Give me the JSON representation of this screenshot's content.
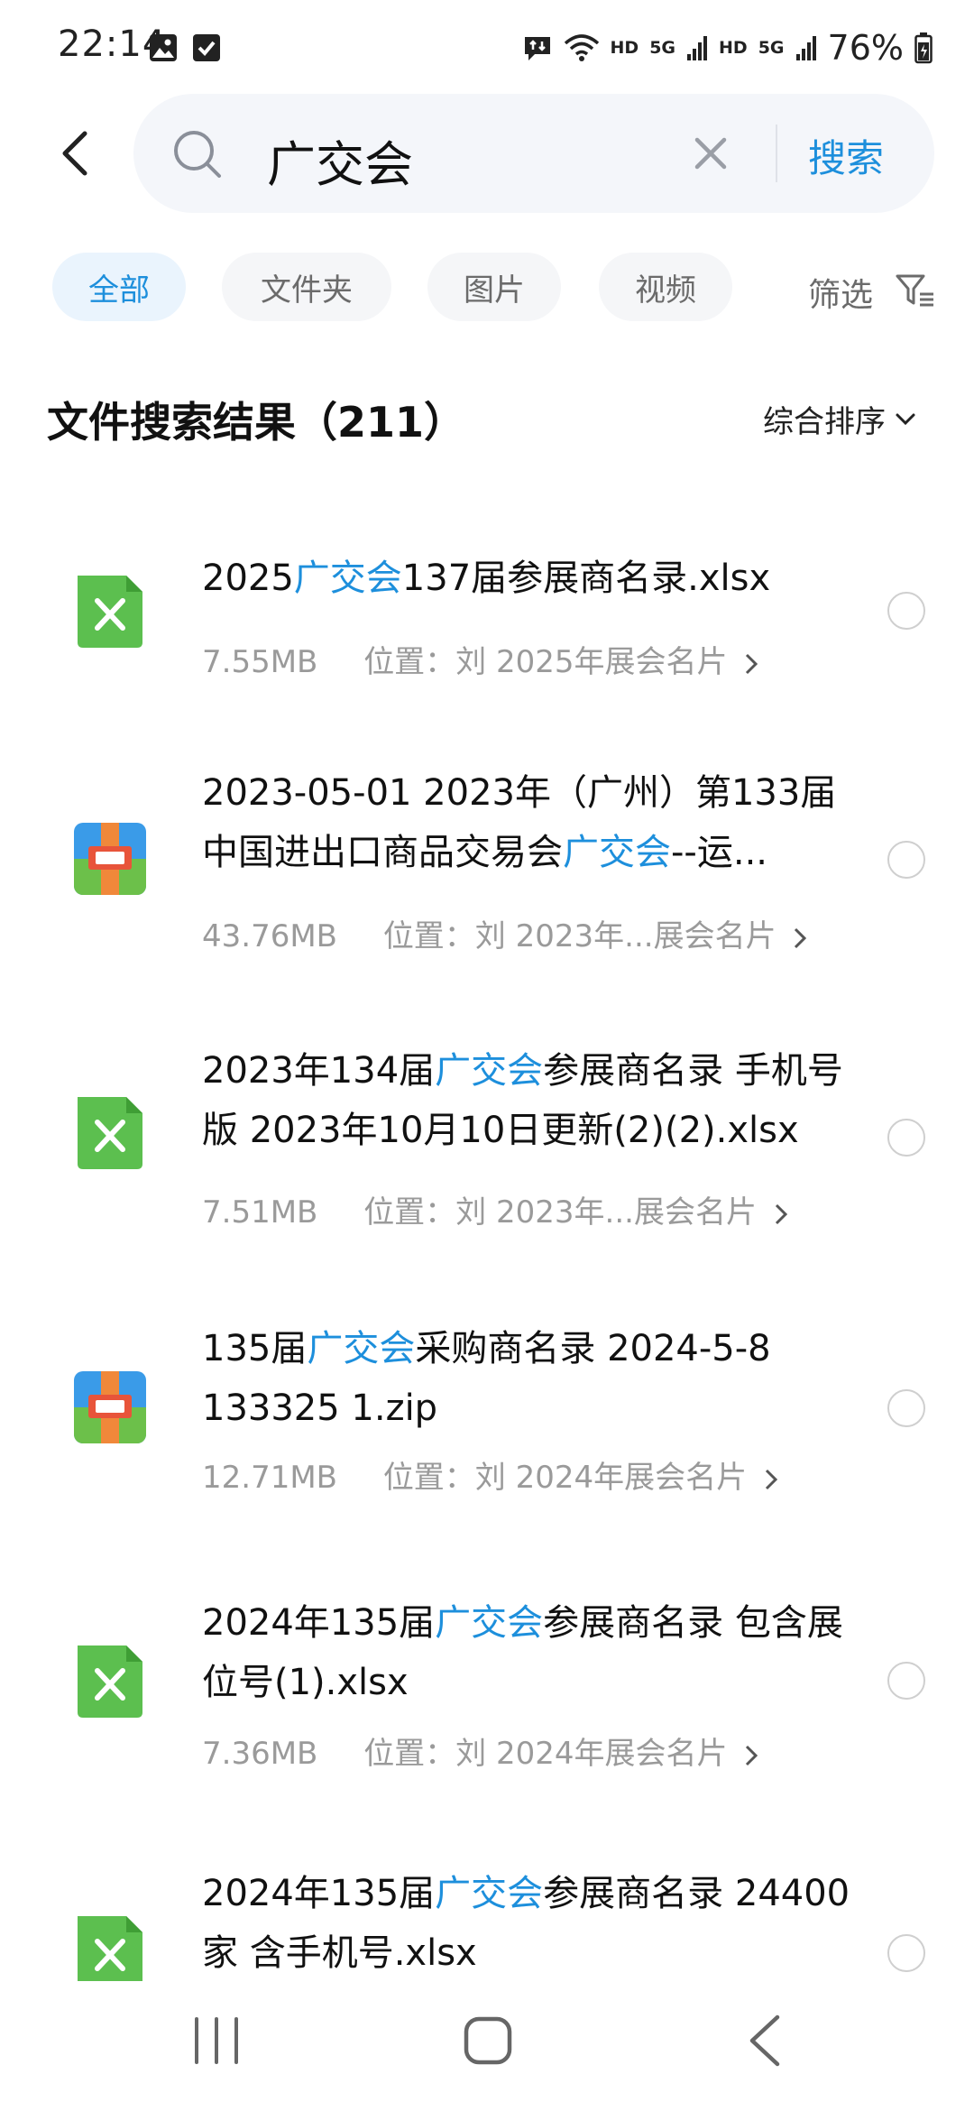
{
  "status_bar": {
    "time": "22:14",
    "hd1": "HD",
    "signal1": "5G",
    "hd2": "HD",
    "signal2": "5G",
    "battery": "76%"
  },
  "search": {
    "query": "广交会",
    "button_label": "搜索"
  },
  "tabs": [
    {
      "label": "全部",
      "active": true
    },
    {
      "label": "文件夹",
      "active": false
    },
    {
      "label": "图片",
      "active": false
    },
    {
      "label": "视频",
      "active": false
    }
  ],
  "filter_label": "筛选",
  "results": {
    "title": "文件搜索结果（211）",
    "sort_label": "综合排序"
  },
  "files": [
    {
      "type": "xlsx",
      "name_parts": [
        "2025",
        "广交会",
        "137届参展商名录.xlsx"
      ],
      "size": "7.55MB",
      "location": "位置：刘 2025年展会名片"
    },
    {
      "type": "zip",
      "name_parts": [
        "2023-05-01  2023年（广州）第133届中国进出口商品交易会",
        "广交会",
        "--运..."
      ],
      "size": "43.76MB",
      "location": "位置：刘 2023年...展会名片"
    },
    {
      "type": "xlsx",
      "name_parts": [
        "2023年134届",
        "广交会",
        "参展商名录 手机号版 2023年10月10日更新(2)(2).xlsx"
      ],
      "size": "7.51MB",
      "location": "位置：刘 2023年...展会名片"
    },
    {
      "type": "zip",
      "name_parts": [
        "135届",
        "广交会",
        "采购商名录 2024-5-8 133325 1.zip"
      ],
      "size": "12.71MB",
      "location": "位置：刘 2024年展会名片"
    },
    {
      "type": "xlsx",
      "name_parts": [
        "2024年135届",
        "广交会",
        "参展商名录 包含展位号(1).xlsx"
      ],
      "size": "7.36MB",
      "location": "位置：刘 2024年展会名片"
    },
    {
      "type": "xlsx",
      "name_parts": [
        "2024年135届",
        "广交会",
        "参展商名录 24400家 含手机号.xlsx"
      ],
      "size": "",
      "location": ""
    }
  ],
  "colors": {
    "accent": "#1d8fdc",
    "xlsx_icon": "#5cbf4f",
    "zip_blue": "#3a9be8",
    "zip_orange": "#f0883a",
    "zip_green": "#6cc04a",
    "zip_red": "#e8543a"
  },
  "icons": {
    "back": "chevron-left-icon",
    "search": "search-icon",
    "clear": "close-icon",
    "filter": "filter-icon",
    "sort": "chevron-down-icon",
    "xlsx": "excel-file-icon",
    "zip": "archive-file-icon"
  }
}
